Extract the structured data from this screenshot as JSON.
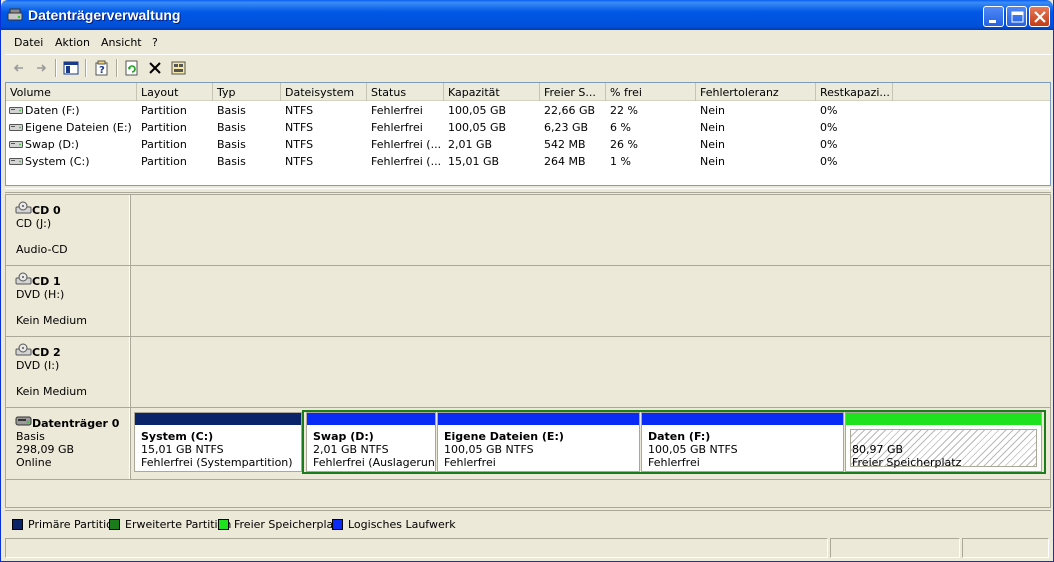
{
  "window": {
    "title": "Datenträgerverwaltung"
  },
  "menu": [
    "Datei",
    "Aktion",
    "Ansicht",
    "?"
  ],
  "columns": [
    "Volume",
    "Layout",
    "Typ",
    "Dateisystem",
    "Status",
    "Kapazität",
    "Freier S...",
    "% frei",
    "Fehlertoleranz",
    "Restkapazi..."
  ],
  "volumes": [
    [
      "Daten (F:)",
      "Partition",
      "Basis",
      "NTFS",
      "Fehlerfrei",
      "100,05 GB",
      "22,66 GB",
      "22 %",
      "Nein",
      "0%"
    ],
    [
      "Eigene Dateien (E:)",
      "Partition",
      "Basis",
      "NTFS",
      "Fehlerfrei",
      "100,05 GB",
      "6,23 GB",
      "6 %",
      "Nein",
      "0%"
    ],
    [
      "Swap (D:)",
      "Partition",
      "Basis",
      "NTFS",
      "Fehlerfrei (...",
      "2,01 GB",
      "542 MB",
      "26 %",
      "Nein",
      "0%"
    ],
    [
      "System (C:)",
      "Partition",
      "Basis",
      "NTFS",
      "Fehlerfrei (...",
      "15,01 GB",
      "264 MB",
      "1 %",
      "Nein",
      "0%"
    ]
  ],
  "disks": [
    {
      "name": "CD 0",
      "line1": "CD (J:)",
      "line2": "Audio-CD"
    },
    {
      "name": "CD 1",
      "line1": "DVD (H:)",
      "line2": "Kein Medium"
    },
    {
      "name": "CD 2",
      "line1": "DVD (I:)",
      "line2": "Kein Medium"
    },
    {
      "name": "Datenträger 0",
      "line1": "Basis",
      "line2": "298,09 GB",
      "line3": "Online"
    }
  ],
  "partitions": [
    {
      "title": "System  (C:)",
      "size": "15,01 GB NTFS",
      "status": "Fehlerfrei (Systempartition)",
      "kind": "primary"
    },
    {
      "title": "Swap  (D:)",
      "size": "2,01 GB NTFS",
      "status": "Fehlerfrei (Auslagerungsdatei)",
      "kind": "logical"
    },
    {
      "title": "Eigene Dateien  (E:)",
      "size": "100,05 GB NTFS",
      "status": "Fehlerfrei",
      "kind": "logical"
    },
    {
      "title": "Daten  (F:)",
      "size": "100,05 GB NTFS",
      "status": "Fehlerfrei",
      "kind": "logical"
    }
  ],
  "free_space": {
    "size": "80,97 GB",
    "label": "Freier Speicherplatz"
  },
  "legend": [
    {
      "label": "Primäre Partition",
      "color": "#0a246a"
    },
    {
      "label": "Erweiterte Partition",
      "color": "#1b7c1b"
    },
    {
      "label": "Freier Speicherplatz",
      "color": "#1de21d"
    },
    {
      "label": "Logisches Laufwerk",
      "color": "#0a2bf5"
    }
  ],
  "colors": {
    "primary": "#0a246a",
    "logical": "#0a2bf5",
    "extended": "#1b7c1b",
    "free": "#1de21d"
  }
}
